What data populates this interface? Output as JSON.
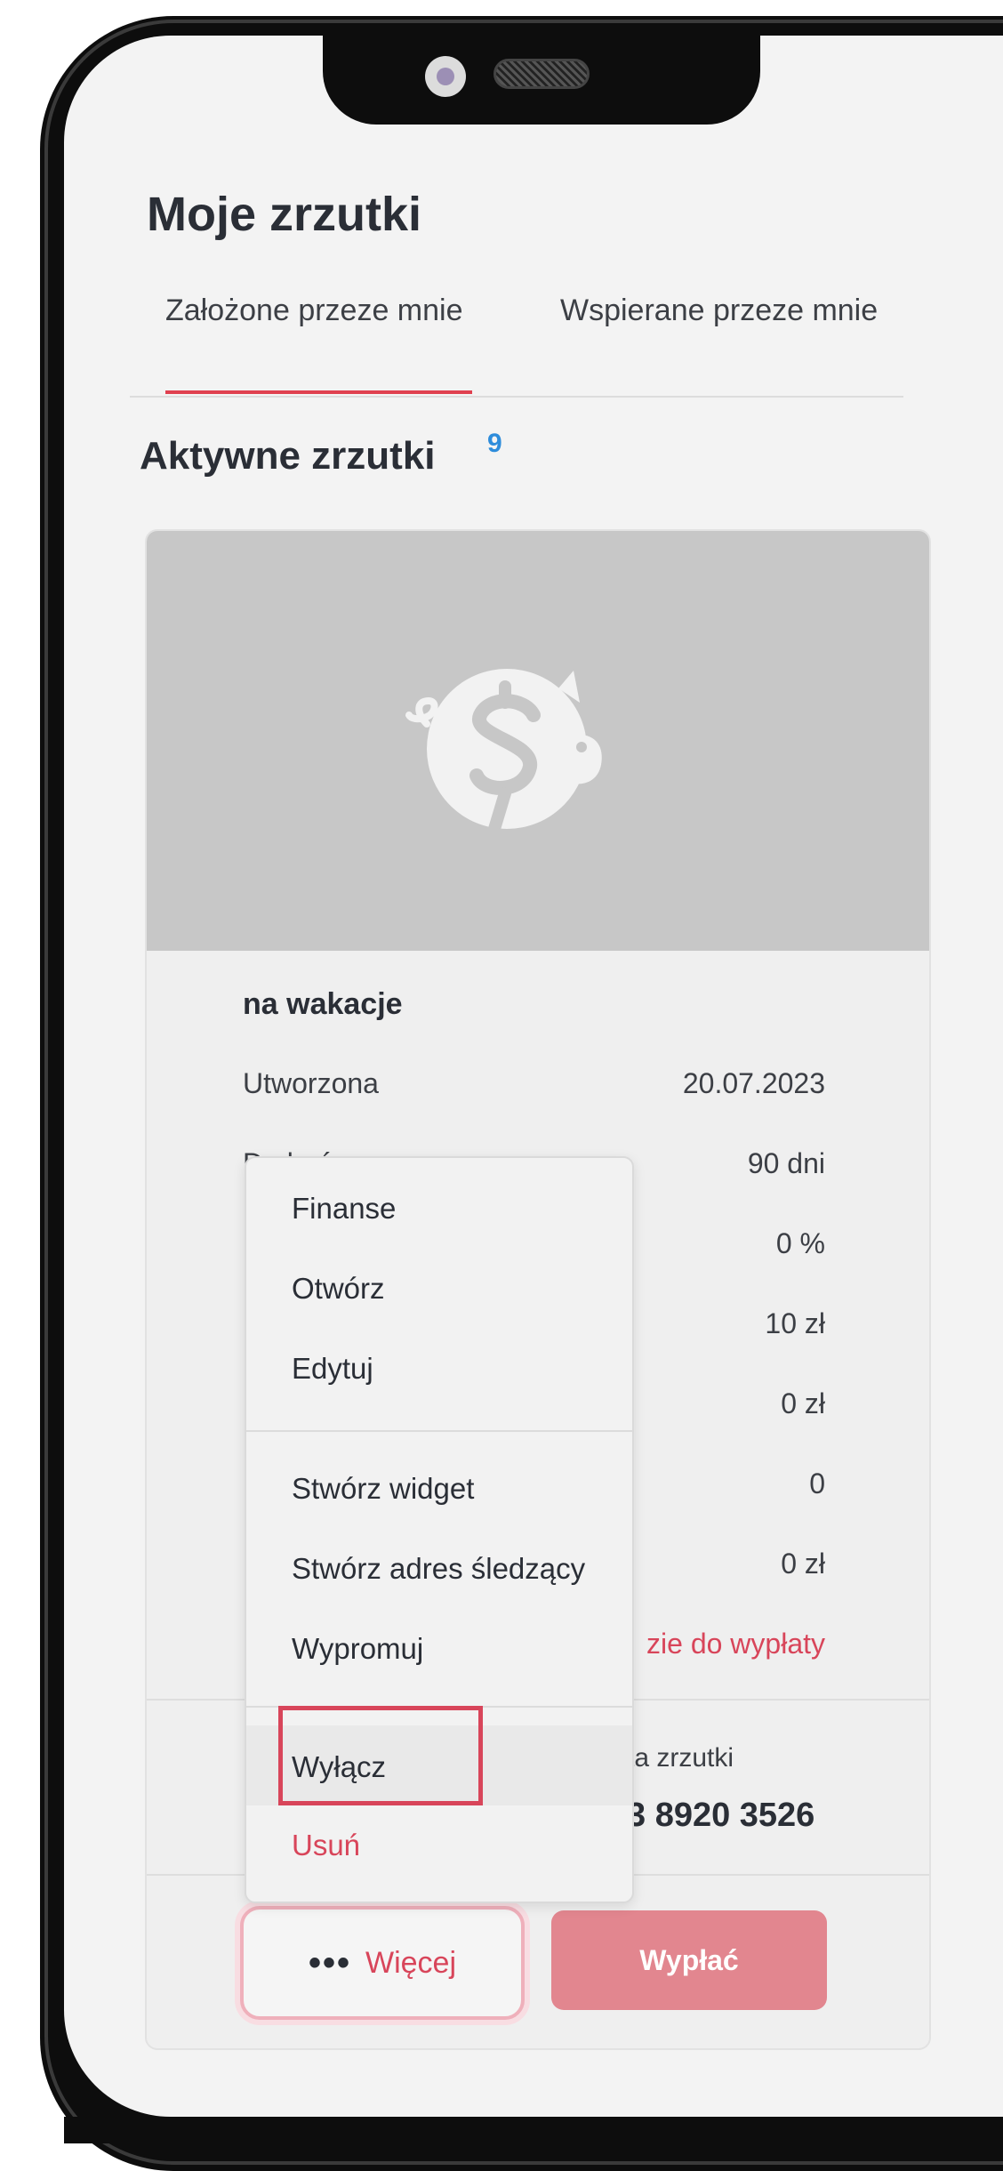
{
  "page": {
    "title": "Moje zrzutki",
    "tabs": [
      {
        "label": "Założone przeze mnie",
        "active": true
      },
      {
        "label": "Wspierane przeze mnie",
        "active": false
      }
    ],
    "section_title": "Aktywne zrzutki",
    "section_count": "9"
  },
  "card": {
    "image_icon": "piggy-bank-dollar-icon",
    "name": "na wakacje",
    "rows": [
      {
        "label": "Utworzona",
        "value": "20.07.2023"
      },
      {
        "label": "Do końca",
        "value": "90 dni"
      },
      {
        "label": "",
        "value": "0 %"
      },
      {
        "label": "",
        "value": "10 zł"
      },
      {
        "label": "",
        "value": "0 zł"
      },
      {
        "label": "",
        "value": "0"
      },
      {
        "label": "",
        "value": "0 zł"
      },
      {
        "label": "",
        "value": "zie do wypłaty"
      }
    ],
    "account_label": "ta zrzutki",
    "account_value": "3 8920 3526",
    "more_dots": "•••",
    "more_label": "Więcej",
    "payout_label": "Wypłać"
  },
  "menu": {
    "items": [
      {
        "label": "Finanse"
      },
      {
        "label": "Otwórz"
      },
      {
        "label": "Edytuj"
      },
      {
        "label": "Stwórz widget"
      },
      {
        "label": "Stwórz adres śledzący"
      },
      {
        "label": "Wypromuj"
      },
      {
        "label": "Wyłącz",
        "highlighted": true
      },
      {
        "label": "Usuń",
        "danger": true
      }
    ]
  },
  "colors": {
    "accent": "#e0404f",
    "danger_text": "#d8455a",
    "count_blue": "#2d8cdb",
    "payout_button": "#e2868f"
  }
}
